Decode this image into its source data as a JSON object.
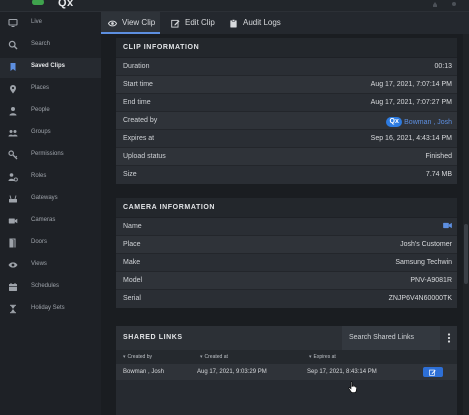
{
  "app": {
    "logo_text": "Qx",
    "accent": "#5d8fe0",
    "brand_green": "#3fa34d"
  },
  "sidebar": {
    "items": [
      {
        "label": "Live",
        "icon": "monitor-icon"
      },
      {
        "label": "Search",
        "icon": "search-icon"
      },
      {
        "label": "Saved Clips",
        "icon": "bookmark-icon"
      },
      {
        "label": "Places",
        "icon": "map-pin-icon"
      },
      {
        "label": "People",
        "icon": "person-icon"
      },
      {
        "label": "Groups",
        "icon": "groups-icon"
      },
      {
        "label": "Permissions",
        "icon": "key-icon"
      },
      {
        "label": "Roles",
        "icon": "roles-icon"
      },
      {
        "label": "Gateways",
        "icon": "gateway-icon"
      },
      {
        "label": "Cameras",
        "icon": "camera-icon"
      },
      {
        "label": "Doors",
        "icon": "door-icon"
      },
      {
        "label": "Views",
        "icon": "eye-icon"
      },
      {
        "label": "Schedules",
        "icon": "calendar-icon"
      },
      {
        "label": "Holiday Sets",
        "icon": "hourglass-icon"
      }
    ],
    "active": "Saved Clips"
  },
  "tabs": [
    {
      "label": "View Clip",
      "icon": "eye-icon"
    },
    {
      "label": "Edit Clip",
      "icon": "edit-icon"
    },
    {
      "label": "Audit Logs",
      "icon": "clipboard-icon"
    }
  ],
  "clip_info": {
    "title": "CLIP INFORMATION",
    "rows": [
      {
        "label": "Duration",
        "value": "00:13"
      },
      {
        "label": "Start time",
        "value": "Aug 17, 2021, 7:07:14 PM"
      },
      {
        "label": "End time",
        "value": "Aug 17, 2021, 7:07:27 PM"
      },
      {
        "label": "Created by",
        "value": "Bowman , Josh"
      },
      {
        "label": "Expires at",
        "value": "Sep 16, 2021, 4:43:14 PM"
      },
      {
        "label": "Upload status",
        "value": "Finished"
      },
      {
        "label": "Size",
        "value": "7.74 MB"
      }
    ]
  },
  "camera_info": {
    "title": "CAMERA INFORMATION",
    "rows": [
      {
        "label": "Name",
        "value": ""
      },
      {
        "label": "Place",
        "value": "Josh's Customer"
      },
      {
        "label": "Make",
        "value": "Samsung Techwin"
      },
      {
        "label": "Model",
        "value": "PNV-A9081R"
      },
      {
        "label": "Serial",
        "value": "ZNJP6V4N60000TK"
      }
    ]
  },
  "shared_links": {
    "title": "SHARED LINKS",
    "search_placeholder": "Search Shared Links",
    "columns": [
      "Created by",
      "Created at",
      "Expires at"
    ],
    "rows": [
      {
        "created_by": "Bowman , Josh",
        "created_at": "Aug 17, 2021, 9:03:29 PM",
        "expires_at": "Sep 17, 2021, 8:43:14 PM"
      }
    ]
  }
}
